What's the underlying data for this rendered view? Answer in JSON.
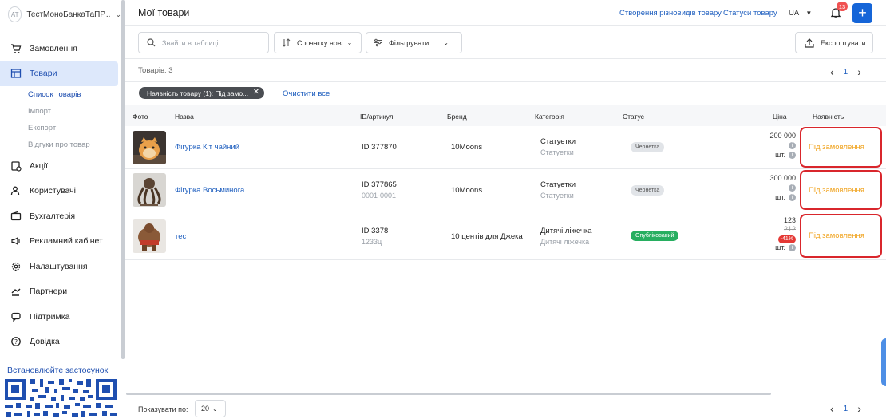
{
  "account": {
    "avatar": "AT",
    "name": "ТестМоноБанкаТаПР..."
  },
  "sidebar": {
    "items": [
      {
        "label": "Замовлення",
        "icon": "cart-icon"
      },
      {
        "label": "Товари",
        "icon": "products-icon",
        "active": true
      },
      {
        "label": "Акції",
        "icon": "promo-icon"
      },
      {
        "label": "Користувачі",
        "icon": "users-icon"
      },
      {
        "label": "Бухгалтерія",
        "icon": "wallet-icon"
      },
      {
        "label": "Рекламний кабінет",
        "icon": "megaphone-icon"
      },
      {
        "label": "Налаштування",
        "icon": "gear-icon"
      },
      {
        "label": "Партнери",
        "icon": "handshake-icon"
      },
      {
        "label": "Підтримка",
        "icon": "chat-icon"
      },
      {
        "label": "Довідка",
        "icon": "help-icon"
      }
    ],
    "subitems": [
      "Список товарів",
      "Імпорт",
      "Експорт",
      "Відгуки про товар"
    ],
    "install": "Встановлюйте застосунок"
  },
  "header": {
    "title": "Мої товари",
    "link_variants": "Створення різновидів товару",
    "link_statuses": "Статуси товару",
    "lang": "UA",
    "notifications": "13",
    "plus": "+"
  },
  "toolbar": {
    "search_placeholder": "Знайти в таблиці...",
    "sort": "Спочатку нові",
    "filter": "Фільтрувати",
    "export": "Експортувати"
  },
  "count": "Товарів: 3",
  "pager": {
    "prev": "‹",
    "page": "1",
    "next": "›"
  },
  "chip": {
    "label": "Наявність товару (1): Під замо...",
    "close": "✕"
  },
  "clear_all": "Очистити все",
  "columns": [
    "Фото",
    "Назва",
    "ID/артикул",
    "Бренд",
    "Категорія",
    "Статус",
    "Ціна",
    "Наявність"
  ],
  "rows": [
    {
      "name": "Фігурка Кіт чайний",
      "id": "ID 377870",
      "sku": "",
      "brand": "10Moons",
      "cat1": "Статуетки",
      "cat2": "Статуетки",
      "status": "Чернетка",
      "status_kind": "draft",
      "price": "200 000",
      "old_price": "",
      "discount": "",
      "unit": "шт.",
      "availability": "Під замовлення"
    },
    {
      "name": "Фігурка Восьминога",
      "id": "ID 377865",
      "sku": "0001-0001",
      "brand": "10Moons",
      "cat1": "Статуетки",
      "cat2": "Статуетки",
      "status": "Чернетка",
      "status_kind": "draft",
      "price": "300 000",
      "old_price": "",
      "discount": "",
      "unit": "шт.",
      "availability": "Під замовлення"
    },
    {
      "name": "тест",
      "id": "ID 3378",
      "sku": "1233ц",
      "brand": "10 центів для Джека",
      "cat1": "Дитячі ліжечка",
      "cat2": "Дитячі ліжечка",
      "status": "Опублікований",
      "status_kind": "pub",
      "price": "123",
      "old_price": "212",
      "discount": "-41%",
      "unit": "шт.",
      "availability": "Під замовлення"
    }
  ],
  "footer": {
    "per_page_label": "Показувати по:",
    "per_page": "20"
  },
  "colors": {
    "accent": "#1565d8",
    "link": "#1f5fbf",
    "avail_border": "#d9262c",
    "avail_text": "#f0a21c",
    "published": "#27ae60"
  }
}
